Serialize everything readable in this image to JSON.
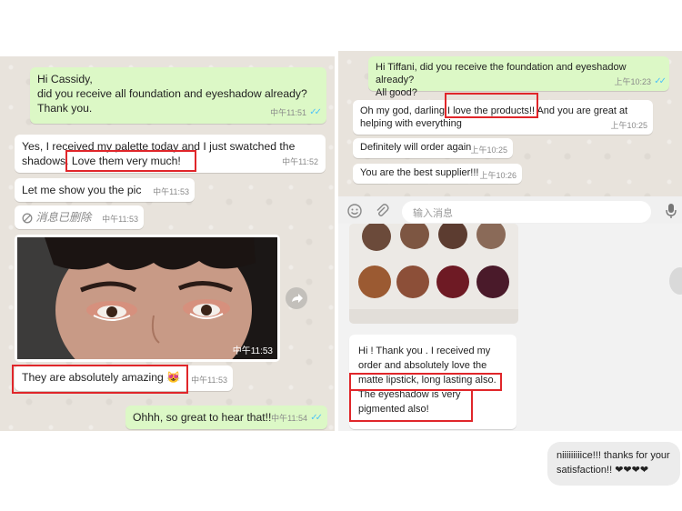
{
  "left_chat": {
    "m1": {
      "line1": "Hi Cassidy,",
      "line2": "did you receive all foundation and eyeshadow already?",
      "line3": "Thank you.",
      "time": "中午11:51"
    },
    "m2": {
      "line1": "Yes, I received my palette today and I just swatched the",
      "line2_prefix": "shadows.",
      "line2_highlight": "Love them very much!",
      "time": "中午11:52"
    },
    "m3": {
      "text": "Let me show you the pic",
      "time": "中午11:53"
    },
    "m4": {
      "text": "消息已删除",
      "time": "中午11:53"
    },
    "photo": {
      "time": "中午11:53"
    },
    "m5": {
      "text": "They are absolutely amazing",
      "emoji": "😻",
      "time": "中午11:53"
    },
    "m6": {
      "text": "Ohhh, so great to hear that!!",
      "time": "中午11:54"
    }
  },
  "right_chat": {
    "m1": {
      "line1": "Hi Tiffani, did you receive the foundation and eyeshadow already?",
      "line2": "All good?",
      "time": "上午10:23"
    },
    "m2": {
      "prefix": "Oh my god, darling",
      "highlight": "I love the products!!",
      "suffix": "And you are great at",
      "line2": "helping with everything",
      "time": "上午10:25"
    },
    "m3": {
      "text": "Definitely will order again",
      "time": "上午10:25"
    },
    "m4": {
      "text": "You are the best supplier!!!",
      "time": "上午10:26"
    },
    "input": {
      "placeholder": "输入消息"
    }
  },
  "review": {
    "line1": "Hi ! Thank you . I received my",
    "line2": "order and absolutely love the",
    "line3": "matte lipstick, long lasting also.",
    "line4": "The eyeshadow is very",
    "line5": "pigmented also!"
  },
  "bottom_chat": {
    "line1": "niiiiiiiiice!!! thanks for your",
    "line2": "satisfaction!! ❤❤❤❤"
  },
  "colors": {
    "outgoing": "#dcf8c6",
    "incoming": "#ffffff",
    "highlight": "#e0262a",
    "ticks": "#4fc3f7"
  }
}
